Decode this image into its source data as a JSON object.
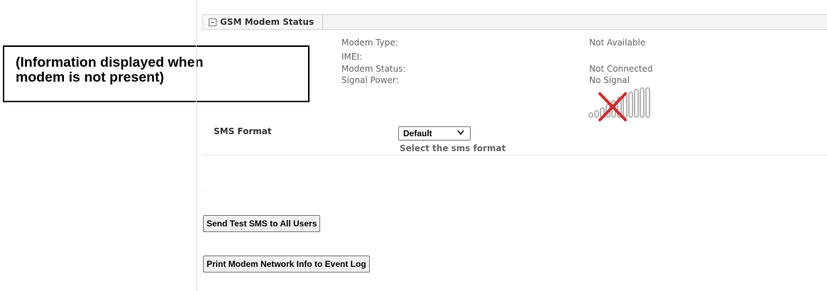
{
  "callout": {
    "line1": "(Information displayed when",
    "line2": "modem is not present)"
  },
  "section": {
    "title": "GSM Modem Status",
    "toggle_icon": "collapse-minus-icon"
  },
  "status": {
    "modem_type_label": "Modem Type:",
    "modem_type_value": "Not Available",
    "imei_label": "IMEI:",
    "imei_value": "",
    "modem_status_label": "Modem Status:",
    "modem_status_value": "Not Connected",
    "signal_power_label": "Signal Power:",
    "signal_power_value": "No Signal",
    "signal_icon": "no-signal-bars-icon"
  },
  "sms": {
    "label": "SMS Format",
    "selected": "Default",
    "help": "Select the sms format"
  },
  "buttons": {
    "send_test": "Send Test SMS to All Users",
    "print_info": "Print Modem Network Info to Event Log"
  },
  "colors": {
    "cross": "#d9262b",
    "bars": "#b5b5b5",
    "border": "#d5d5d5"
  }
}
